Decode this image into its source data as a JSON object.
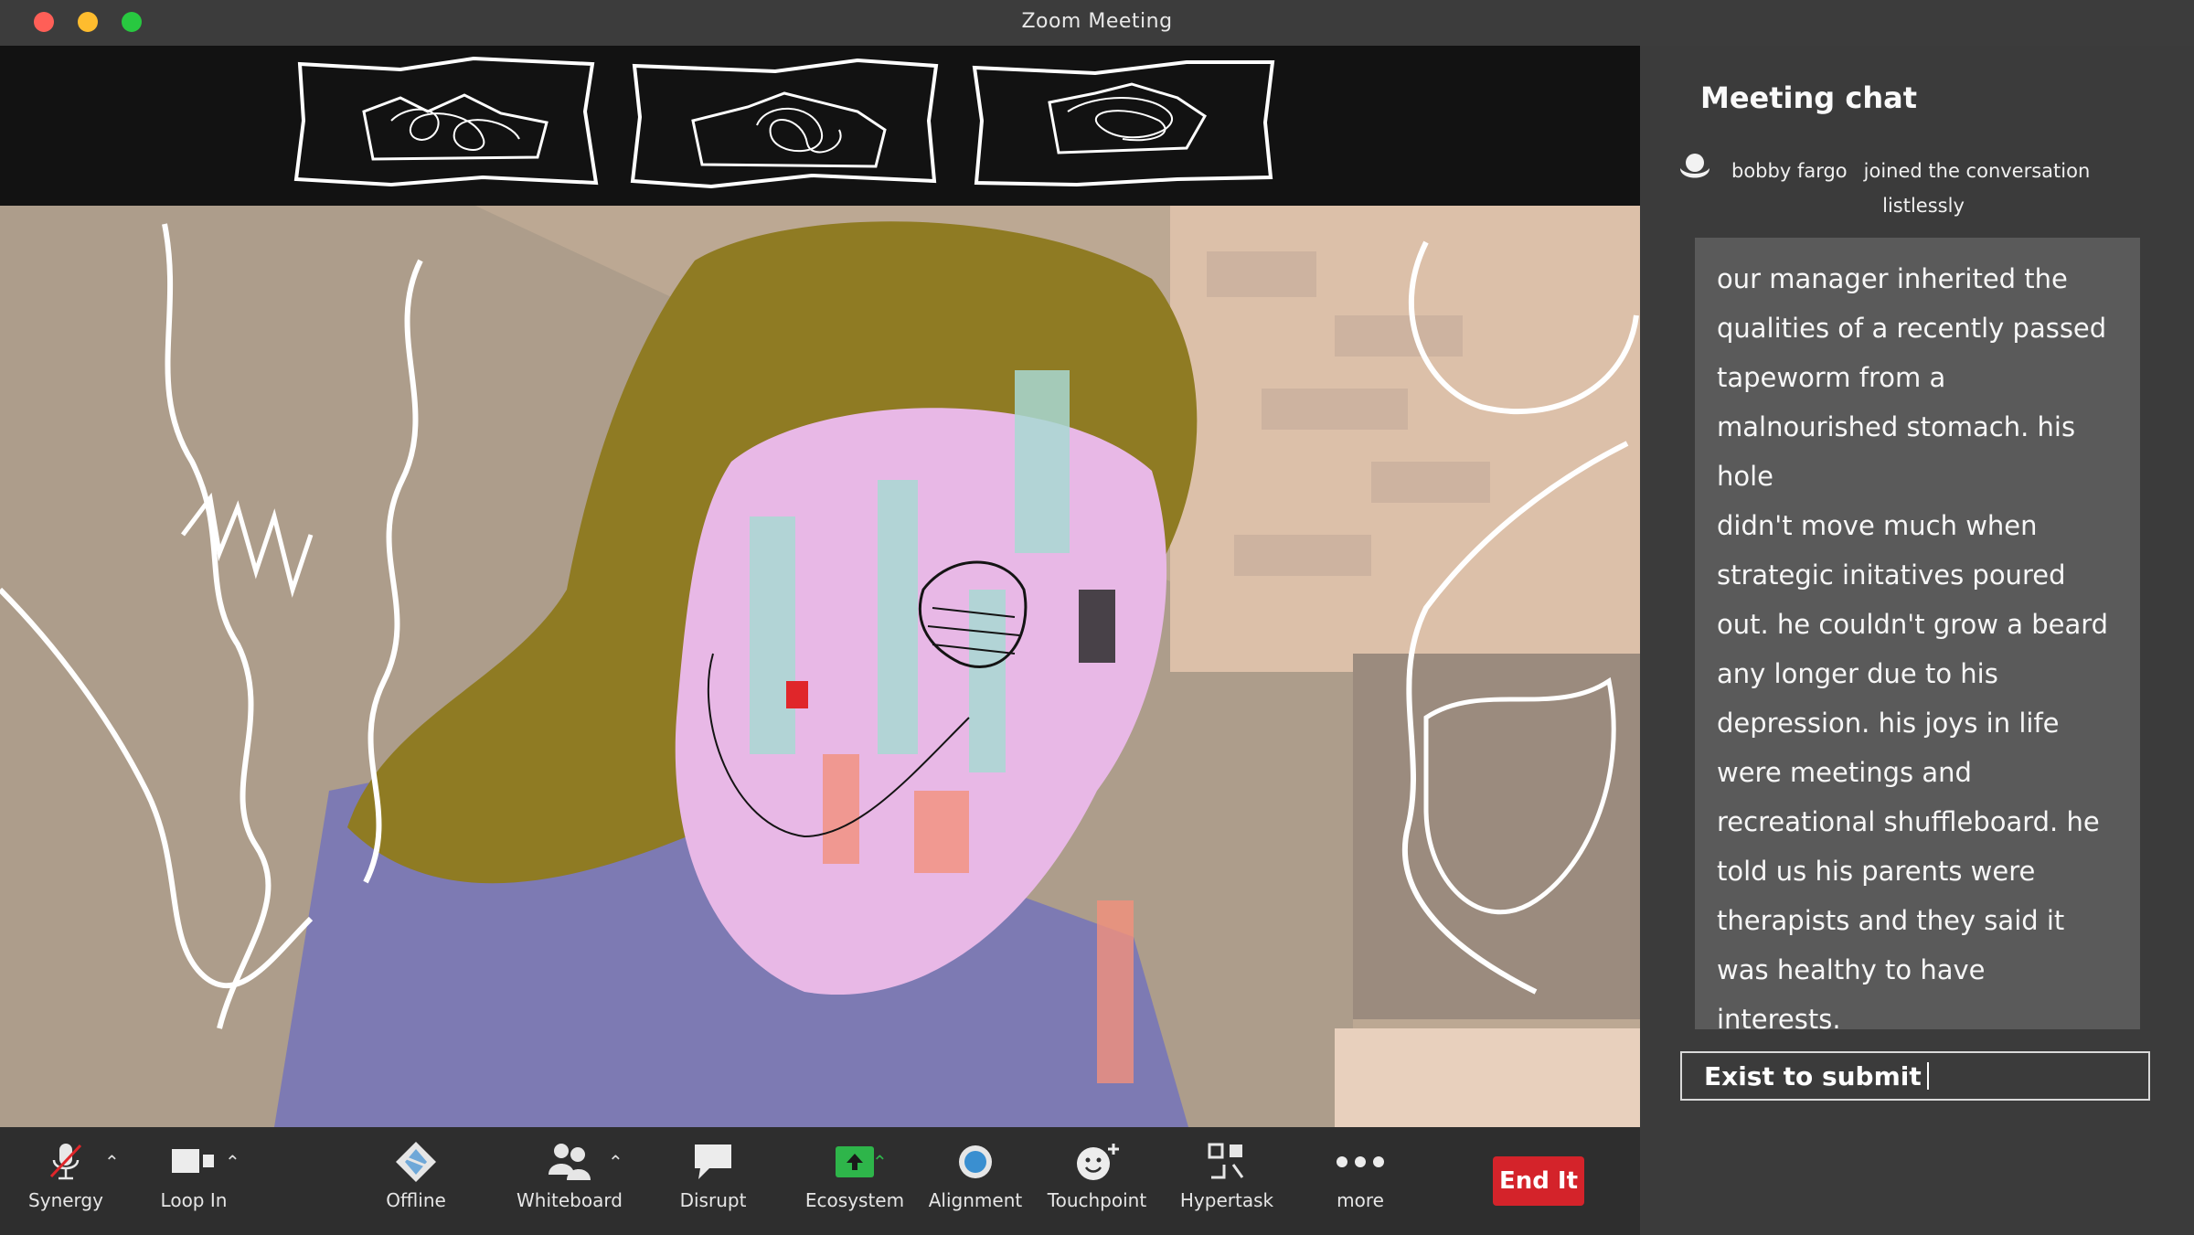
{
  "window": {
    "title": "Zoom Meeting",
    "traffic_lights": {
      "close": "#ff5f57",
      "minimize": "#febc2e",
      "zoom": "#28c840"
    }
  },
  "participant_thumbnails": [
    {
      "icon": "scribble-avatar-icon"
    },
    {
      "icon": "scribble-avatar-icon"
    },
    {
      "icon": "scribble-avatar-icon"
    }
  ],
  "toolbar": {
    "items": [
      {
        "label": "Synergy",
        "icon": "microphone-muted-icon"
      },
      {
        "label": "Loop In",
        "icon": "video-camera-icon"
      },
      {
        "label": "Offline",
        "icon": "diamond-icon"
      },
      {
        "label": "Whiteboard",
        "icon": "participants-icon"
      },
      {
        "label": "Disrupt",
        "icon": "chat-bubble-icon"
      },
      {
        "label": "Ecosystem",
        "icon": "share-screen-icon"
      },
      {
        "label": "Alignment",
        "icon": "record-icon"
      },
      {
        "label": "Touchpoint",
        "icon": "reactions-icon"
      },
      {
        "label": "Hypertask",
        "icon": "apps-icon"
      },
      {
        "label": "more",
        "icon": "more-dots-icon"
      }
    ],
    "end_label": "End It",
    "end_color": "#d4232a",
    "share_color": "#2eb54a"
  },
  "chat": {
    "title": "Meeting chat",
    "join": {
      "user": "bobby fargo",
      "action": "joined the conversation",
      "manner": "listlessly"
    },
    "message_lines": [
      "our manager inherited the",
      "qualities of a recently passed",
      "tapeworm from a",
      "malnourished stomach. his hole",
      "didn't move much when",
      "strategic initatives poured",
      "out. he couldn't grow a beard",
      "any longer due to his",
      "depression. his joys in life",
      "were meetings and",
      "recreational shuffleboard. he",
      "told us his parents were",
      "therapists and they said it",
      "was healthy to have",
      "interests."
    ],
    "input_value": "Exist to submit"
  }
}
